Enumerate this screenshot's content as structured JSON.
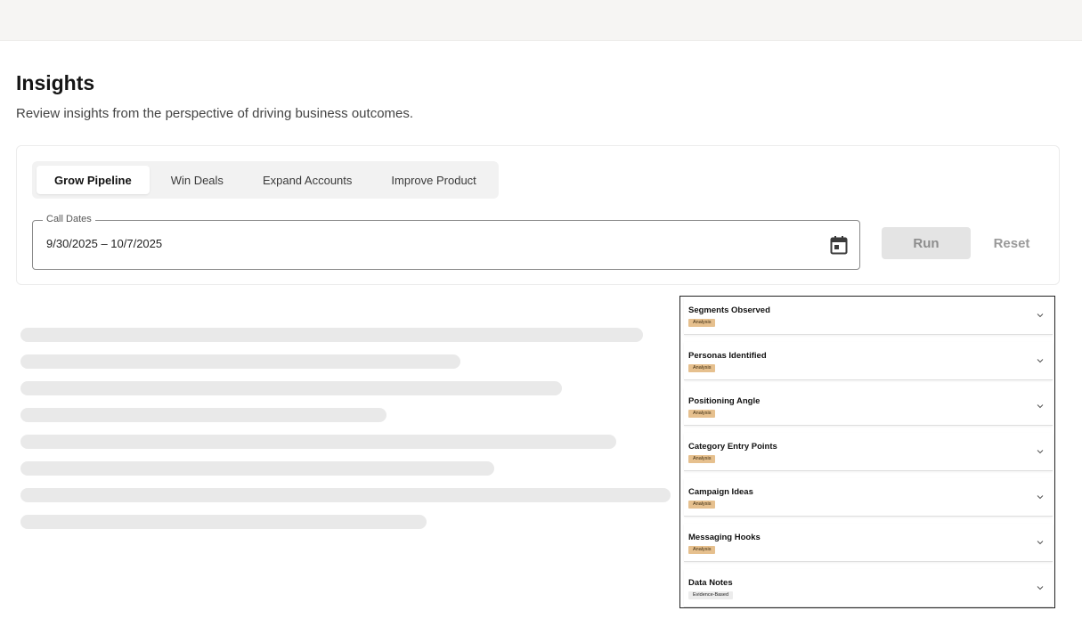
{
  "header": {
    "title": "Insights",
    "subtitle": "Review insights from the perspective of driving business outcomes."
  },
  "tabs": [
    {
      "label": "Grow Pipeline",
      "active": true
    },
    {
      "label": "Win Deals",
      "active": false
    },
    {
      "label": "Expand Accounts",
      "active": false
    },
    {
      "label": "Improve Product",
      "active": false
    }
  ],
  "filters": {
    "date_label": "Call Dates",
    "date_value": "9/30/2025 – 10/7/2025",
    "run_label": "Run",
    "reset_label": "Reset"
  },
  "accordion": [
    {
      "title": "Segments Observed",
      "badge": "Analysis"
    },
    {
      "title": "Personas Identified",
      "badge": "Analysis"
    },
    {
      "title": "Positioning Angle",
      "badge": "Analysis"
    },
    {
      "title": "Category Entry Points",
      "badge": "Analysis"
    },
    {
      "title": "Campaign Ideas",
      "badge": "Analysis"
    },
    {
      "title": "Messaging Hooks",
      "badge": "Analysis"
    },
    {
      "title": "Data Notes",
      "badge": "Evidence-Based"
    }
  ],
  "colors": {
    "badge_analysis": "#e6c08e",
    "badge_evidence": "#ececec",
    "skeleton": "#e9e9e9"
  }
}
